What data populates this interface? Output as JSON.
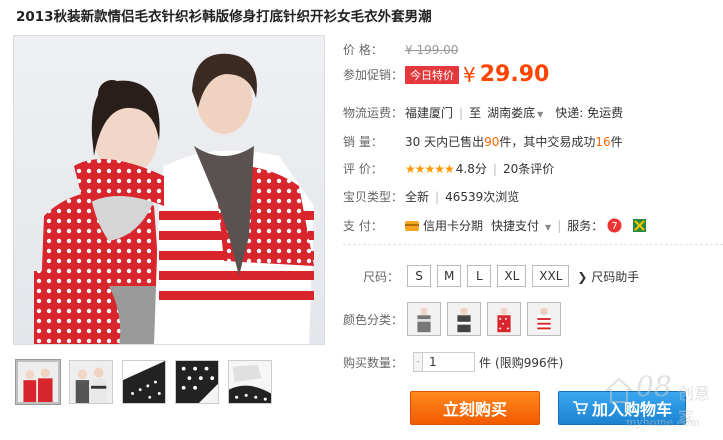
{
  "title": "2013秋装新款情侣毛衣针织衫韩版修身打底针织开衫女毛衣外套男潮",
  "price": {
    "label": "价 格：",
    "original": "¥ 199.00"
  },
  "promo": {
    "label": "参加促销：",
    "tag": "今日特价",
    "currency": "¥",
    "price": "29.90"
  },
  "shipping": {
    "label": "物流运费：",
    "from": "福建厦门",
    "to_prefix": "至",
    "to": "湖南娄底",
    "fee": "快递: 免运费"
  },
  "sales": {
    "label": "销 量：",
    "text_before": "30 天内已售出 ",
    "sold": "90",
    "text_mid": " 件，其中交易成功 ",
    "success": "16",
    "text_after": " 件"
  },
  "review": {
    "label": "评 价：",
    "stars": "★★★★★",
    "score": "4.8分",
    "count": "20条评价"
  },
  "type": {
    "label": "宝贝类型：",
    "condition": "全新",
    "views": "46539次浏览"
  },
  "payment": {
    "label": "支 付：",
    "installment": "信用卡分期",
    "quick": "快捷支付",
    "service_label": "服务："
  },
  "sizes": {
    "label": "尺码：",
    "options": [
      "S",
      "M",
      "L",
      "XL",
      "XXL"
    ],
    "helper": "尺码助手"
  },
  "colors": {
    "label": "颜色分类："
  },
  "quantity": {
    "label": "购买数量：",
    "value": "1",
    "unit": "件",
    "stock": "(限购996件)"
  },
  "actions": {
    "buy_now": "立刻购买",
    "add_to_cart": "加入购物车"
  },
  "watermark": {
    "brand": "08",
    "cn": "创意家",
    "url": "myhome.com"
  },
  "colors_theme": {
    "price": "#ff4400",
    "promo_tag": "#e4393c",
    "buy_button": "#f25a00",
    "cart_button": "#1b83d3"
  }
}
